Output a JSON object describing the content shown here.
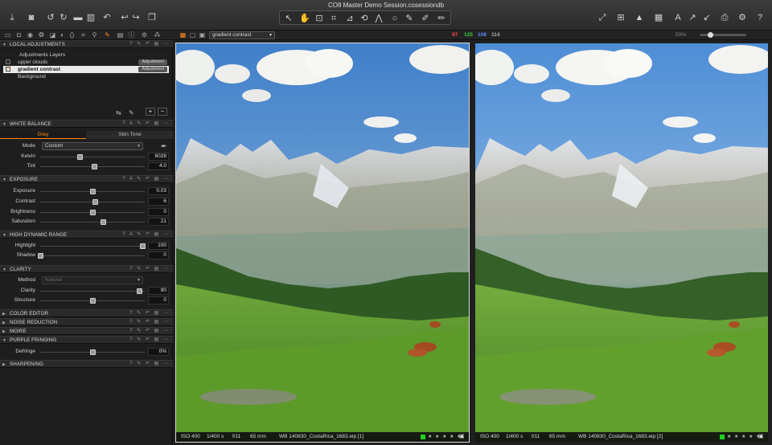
{
  "window": {
    "title": "CO8 Master Demo Session.cosessiondb"
  },
  "toolbar": {
    "left_icons": [
      "import-icon",
      "camera-icon",
      "rotate-left-icon",
      "rotate-right-icon",
      "folder-icon",
      "trash-icon",
      "undo-icon",
      "undo-step-icon",
      "redo-icon",
      "copy-stack-icon"
    ],
    "center_tools": [
      "select-icon",
      "pan-icon",
      "loupe-icon",
      "crop-icon",
      "straighten-icon",
      "rotate-tool-icon",
      "keystone-icon",
      "spot-removal-icon",
      "brush-icon",
      "eraser-icon",
      "gradient-icon"
    ],
    "right_icons": [
      "expand-icon",
      "grid-icon",
      "warning-icon",
      "histogram-icon",
      "text-icon",
      "cursor-icon",
      "pick-icon",
      "print-icon",
      "settings-icon",
      "help-icon"
    ]
  },
  "viewer_bar": {
    "variant": "gradient contrast",
    "rgb": {
      "r": "97",
      "g": "125",
      "b": "108",
      "l": "114"
    },
    "rgb_colors": {
      "r": "#ff4a4a",
      "g": "#3fd13f",
      "b": "#5a8cff",
      "l": "#aaaaaa"
    },
    "zoom": "50%"
  },
  "tool_tabs": [
    "folder-tab-icon",
    "capture-tab-icon",
    "lens-tab-icon",
    "color-tab-icon",
    "exposure-tab-icon",
    "detail-tab-icon",
    "local-adjust-tab-icon",
    "crop-tab-icon",
    "focus-tab-icon",
    "brush-tab-icon",
    "output-tab-icon",
    "meta-tab-icon",
    "settings-tab-icon",
    "batch-tab-icon"
  ],
  "local_adjustments": {
    "title": "LOCAL ADJUSTMENTS",
    "layers_header": "Adjustments Layers",
    "layers": [
      {
        "name": "upper clouds",
        "badge": "Adjustment",
        "checked": false,
        "selected": false
      },
      {
        "name": "gradient contrast",
        "badge": "Adjustment",
        "checked": true,
        "selected": true
      },
      {
        "name": "Background",
        "badge": "",
        "checked": false,
        "selected": false
      }
    ]
  },
  "white_balance": {
    "title": "WHITE BALANCE",
    "tabs": [
      "Grey",
      "Skin Tone"
    ],
    "mode_label": "Mode",
    "mode_value": "Custom",
    "kelvin_label": "Kelvin",
    "kelvin_value": "6028",
    "kelvin_pos": 0.38,
    "tint_label": "Tint",
    "tint_value": "4.0",
    "tint_pos": 0.52
  },
  "exposure": {
    "title": "EXPOSURE",
    "sliders": [
      {
        "label": "Exposure",
        "value": "0.03",
        "pos": 0.5
      },
      {
        "label": "Contrast",
        "value": "6",
        "pos": 0.53
      },
      {
        "label": "Brightness",
        "value": "0",
        "pos": 0.5
      },
      {
        "label": "Saturation",
        "value": "21",
        "pos": 0.6
      }
    ]
  },
  "hdr": {
    "title": "HIGH DYNAMIC RANGE",
    "sliders": [
      {
        "label": "Highlight",
        "value": "100",
        "pos": 0.98
      },
      {
        "label": "Shadow",
        "value": "0",
        "pos": 0.0
      }
    ]
  },
  "clarity": {
    "title": "CLARITY",
    "method_label": "Method",
    "method_value": "Natural",
    "sliders": [
      {
        "label": "Clarity",
        "value": "90",
        "pos": 0.95
      },
      {
        "label": "Structure",
        "value": "0",
        "pos": 0.5
      }
    ]
  },
  "collapsed_sections": [
    "COLOR EDITOR",
    "NOISE REDUCTION",
    "MOIRE"
  ],
  "purple_fringing": {
    "title": "PURPLE FRINGING",
    "slider": {
      "label": "Defringe",
      "value": "0%",
      "pos": 0.5
    }
  },
  "sharpening": {
    "title": "SHARPENING"
  },
  "photos": [
    {
      "iso": "ISO 400",
      "shutter": "1/400 s",
      "aperture": "f/11",
      "focal": "65 mm",
      "file": "WB 140830_CostaRica_1683.eip [1]",
      "stars": "★ ★ ★ ★ ★"
    },
    {
      "iso": "ISO 400",
      "shutter": "1/400 s",
      "aperture": "f/11",
      "focal": "65 mm",
      "file": "WB 140830_CostaRica_1683.eip [2]",
      "stars": "★ ★ ★ ★ ★"
    }
  ]
}
